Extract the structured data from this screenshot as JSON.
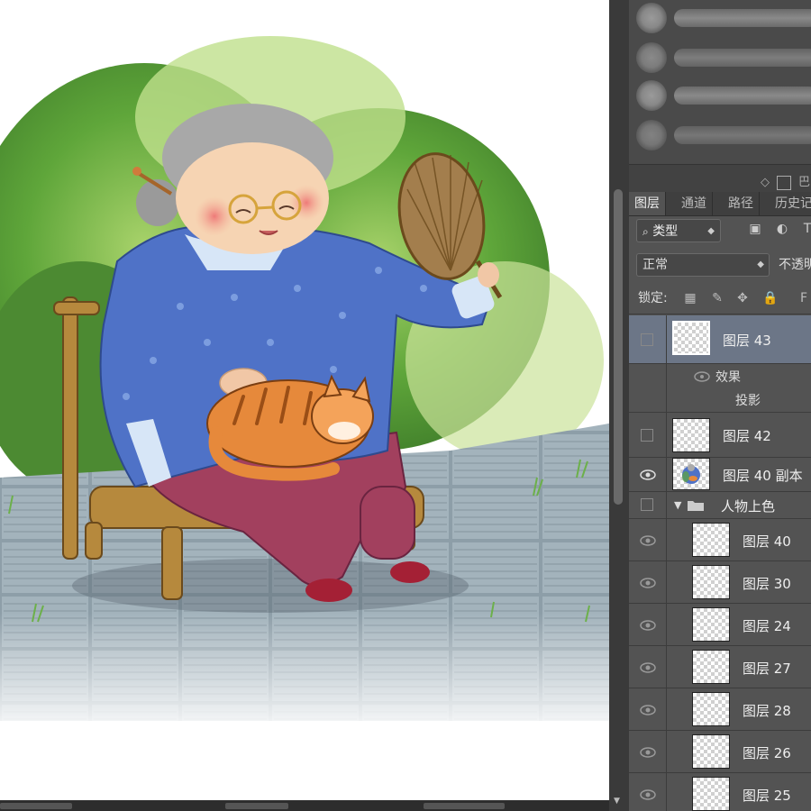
{
  "canvas": {
    "artwork": "illustration"
  },
  "brush_panel": {
    "tools_label": "◇",
    "tools_box": "",
    "tools_trail": "巴"
  },
  "layers_panel": {
    "tabs": [
      {
        "label": "图层",
        "active": true
      },
      {
        "label": "通道",
        "active": false
      },
      {
        "label": "路径",
        "active": false
      },
      {
        "label": "历史记",
        "active": false
      }
    ],
    "filter": {
      "prefix_icon": "search-icon",
      "value": "类型",
      "arrow": "⌃"
    },
    "blend_mode": {
      "value": "正常",
      "arrow": "⌃"
    },
    "opacity_label": "不透明",
    "lock_label": "锁定:",
    "layers": [
      {
        "name": "图层 43",
        "visible": false,
        "selected": true,
        "effects": {
          "label": "效果",
          "items": [
            "投影"
          ]
        }
      },
      {
        "name": "图层 42",
        "visible": false,
        "selected": false
      },
      {
        "name": "图层 40 副本",
        "visible": true,
        "selected": false,
        "has_artwork": true
      },
      {
        "name": "人物上色",
        "visible": false,
        "group": true,
        "expanded": true
      },
      {
        "name": "图层 40",
        "visible": true,
        "indented": true
      },
      {
        "name": "图层 30",
        "visible": true,
        "indented": true
      },
      {
        "name": "图层 24",
        "visible": true,
        "indented": true
      },
      {
        "name": "图层 27",
        "visible": true,
        "indented": true
      },
      {
        "name": "图层 28",
        "visible": true,
        "indented": true
      },
      {
        "name": "图层 26",
        "visible": true,
        "indented": true
      },
      {
        "name": "图层 25",
        "visible": true,
        "indented": true
      }
    ]
  },
  "colors": {
    "panel_bg": "#535353",
    "selected_layer": "#6c7687",
    "tab_bar": "#3f3f3f"
  }
}
